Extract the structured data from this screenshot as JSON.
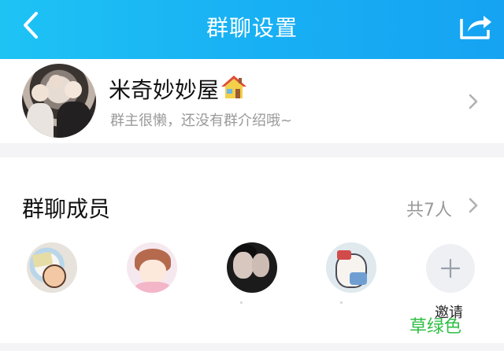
{
  "header": {
    "title": "群聊设置"
  },
  "group": {
    "name": "米奇妙妙屋",
    "name_emoji": "house-icon",
    "description": "群主很懒，还没有群介绍哦~"
  },
  "members": {
    "title": "群聊成员",
    "count_label": "共7人",
    "avatars": [
      "member-avatar-1",
      "member-avatar-2",
      "member-avatar-3",
      "member-avatar-4"
    ],
    "invite_label": "邀请"
  },
  "watermark": "草绿色",
  "colors": {
    "header_start": "#1ec3f4",
    "header_end": "#15a3f2",
    "watermark": "#2fbf45"
  }
}
